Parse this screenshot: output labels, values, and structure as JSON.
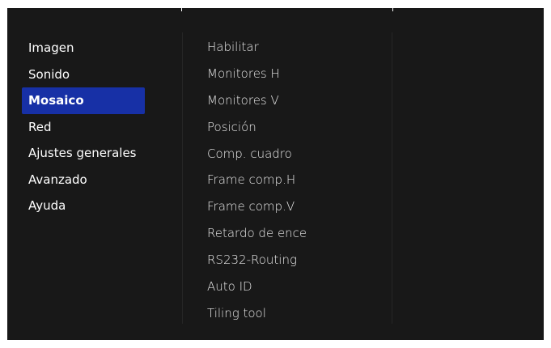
{
  "main_menu": {
    "items": [
      {
        "label": "Imagen"
      },
      {
        "label": "Sonido"
      },
      {
        "label": "Mosaico"
      },
      {
        "label": "Red"
      },
      {
        "label": "Ajustes generales"
      },
      {
        "label": "Avanzado"
      },
      {
        "label": "Ayuda"
      }
    ],
    "selected": "Mosaico"
  },
  "sub_menu": {
    "items": [
      {
        "label": "Habilitar"
      },
      {
        "label": "Monitores H"
      },
      {
        "label": "Monitores V"
      },
      {
        "label": "Posición"
      },
      {
        "label": "Comp. cuadro"
      },
      {
        "label": "Frame comp.H"
      },
      {
        "label": "Frame comp.V"
      },
      {
        "label": "Retardo de ence"
      },
      {
        "label": "RS232-Routing"
      },
      {
        "label": "Auto ID"
      },
      {
        "label": "Tiling tool"
      }
    ]
  },
  "colors": {
    "background": "#181818",
    "selection": "#1730a6",
    "text": "#ffffff"
  }
}
